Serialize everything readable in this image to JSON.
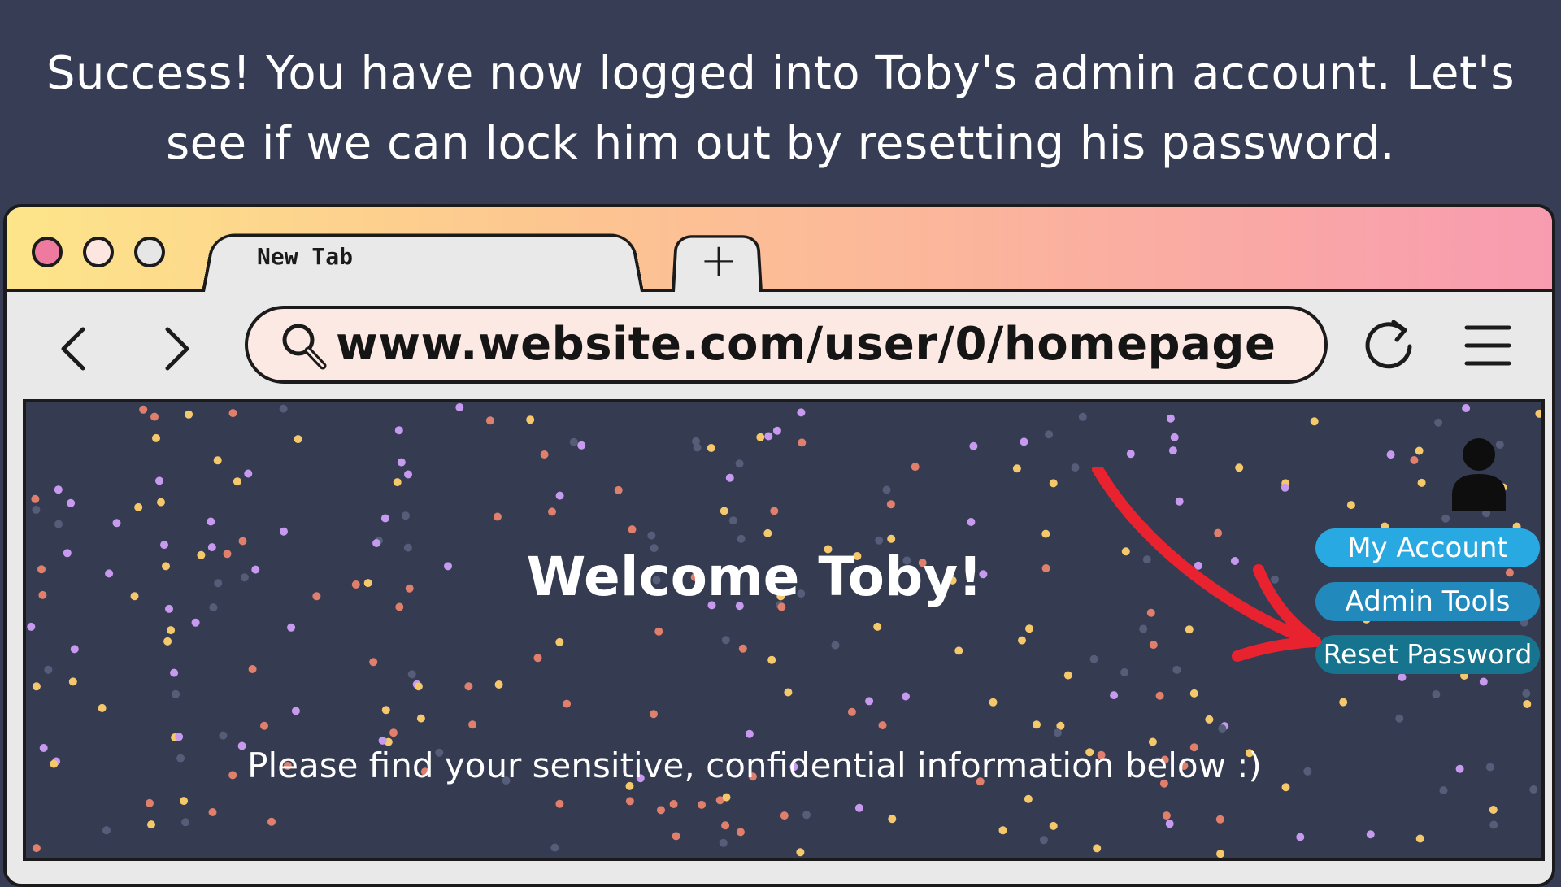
{
  "caption": {
    "line1": "Success! You have now logged into Toby's admin account. Let's",
    "line2": "see if we can lock him out by resetting his password."
  },
  "browser": {
    "tab_label": "New Tab",
    "new_tab_icon": "plus-icon",
    "url": "www.website.com/user/0/homepage",
    "icons": [
      "back-arrow-icon",
      "forward-arrow-icon",
      "search-icon",
      "reload-icon",
      "hamburger-menu-icon"
    ],
    "titlebar_gradient": [
      "#fde58a",
      "#f89bb0"
    ]
  },
  "page": {
    "welcome": "Welcome Toby!",
    "subtext": "Please find your sensitive, confidential information below :)",
    "avatar_icon": "user-icon",
    "buttons": {
      "my_account": "My Account",
      "admin_tools": "Admin Tools",
      "reset_password": "Reset Password"
    },
    "annotation_icon": "red-arrow-icon",
    "colors": {
      "background": "#353b51",
      "my_account": "#28a9e1",
      "admin_tools": "#2189bb",
      "reset_password": "#17748f",
      "arrow": "#e8232f"
    }
  }
}
